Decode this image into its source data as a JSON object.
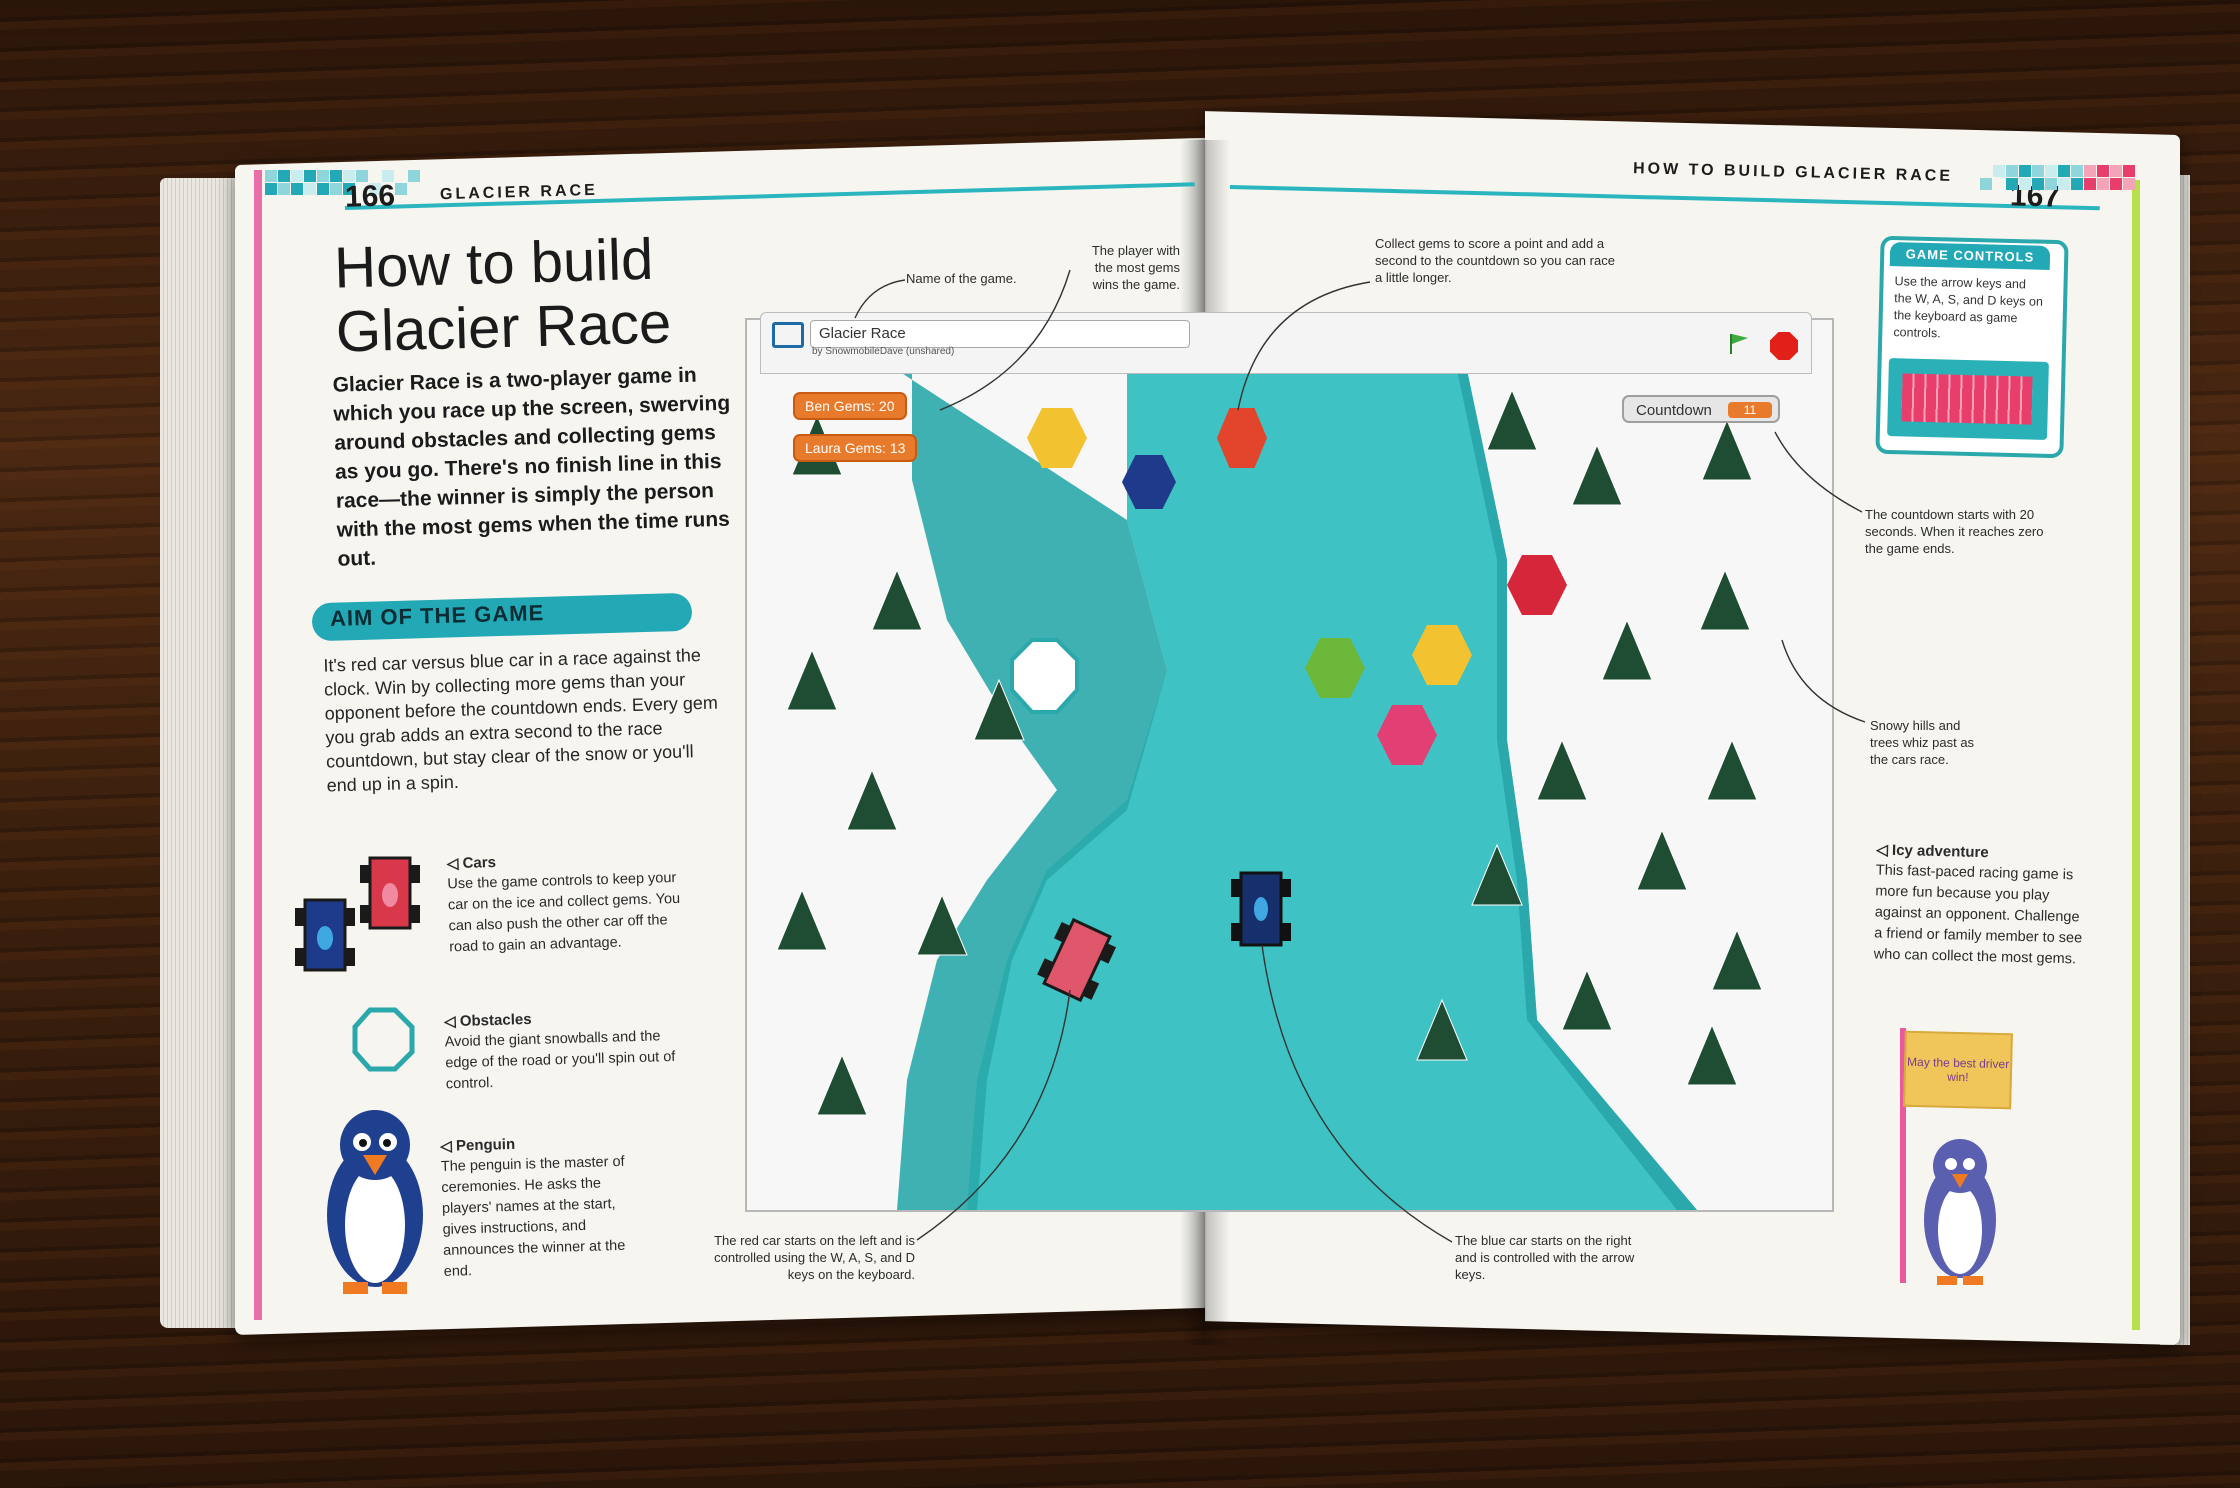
{
  "header": {
    "left_page_number": "166",
    "left_running_head": "GLACIER RACE",
    "right_running_head": "HOW TO BUILD GLACIER RACE",
    "right_page_number": "167"
  },
  "left": {
    "title_line1": "How to build",
    "title_line2": "Glacier Race",
    "intro": "Glacier Race is a two-player game in which you race up the screen, swerving around obstacles and collecting gems as you go. There's no finish line in this race—the winner is simply the person with the most gems when the time runs out.",
    "aim_title": "AIM OF THE GAME",
    "aim_body": "It's red car versus blue car in a race against the clock. Win by collecting more gems than your opponent before the countdown ends. Every gem you grab adds an extra second to the race countdown, but stay clear of the snow or you'll end up in a spin.",
    "cars_title": "◁ Cars",
    "cars_body": "Use the game controls to keep your car on the ice and collect gems. You can also push the other car off the road to gain an advantage.",
    "obstacles_title": "◁ Obstacles",
    "obstacles_body": "Avoid the giant snowballs and the edge of the road or you'll spin out of control.",
    "penguin_title": "◁ Penguin",
    "penguin_body": "The penguin is the master of ceremonies. He asks the players' names at the start, gives instructions, and announces the winner at the end."
  },
  "annotations": {
    "name_of_game": "Name of the game.",
    "most_gems": "The player with the most gems wins the game.",
    "collect_gems": "Collect gems to score a point and add a second to the countdown so you can race a little longer.",
    "countdown": "The countdown starts with 20 seconds. When it reaches zero the game ends.",
    "snowy_hills": "Snowy hills and trees whiz past as the cars race.",
    "red_car": "The red car starts on the left and is controlled using the W, A, S, and D keys on the keyboard.",
    "blue_car": "The blue car starts on the right and is controlled with the arrow keys."
  },
  "game": {
    "title": "Glacier Race",
    "byline": "by SnowmobileDave (unshared)",
    "ben_gems": "Ben Gems: 20",
    "laura_gems": "Laura Gems: 13",
    "countdown_label": "Countdown",
    "countdown_value": "11"
  },
  "right": {
    "controls_title": "GAME CONTROLS",
    "controls_body": "Use the arrow keys and the W, A, S, and D keys on the keyboard as game controls.",
    "icy_title": "◁ Icy adventure",
    "icy_body": "This fast-paced racing game is more fun because you play against an opponent. Challenge a friend or family member to see who can collect the most gems.",
    "sign_text": "May the best driver win!"
  },
  "colors": {
    "teal_accent": "#23a8b6",
    "river": "#3fc2c3",
    "orange_variable": "#e87a2b",
    "tree_green": "#1f4d33"
  }
}
